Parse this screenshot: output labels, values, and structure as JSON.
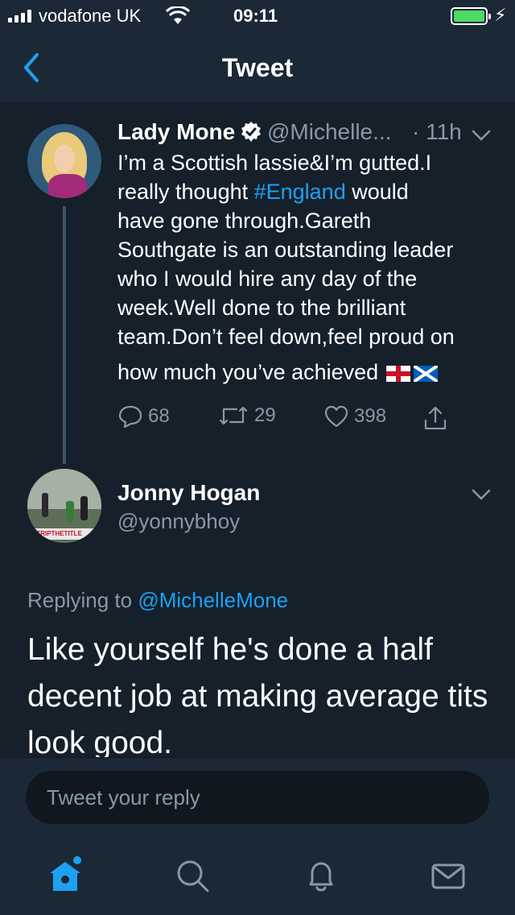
{
  "status_bar": {
    "carrier": "vodafone UK",
    "time": "09:11",
    "colors": {
      "battery": "#4cd964"
    }
  },
  "header": {
    "title": "Tweet",
    "back_icon": "chevron-left-icon"
  },
  "tweet": {
    "author_name": "Lady Mone",
    "verified": true,
    "handle": "@Michelle...",
    "time": "· 11h",
    "body_lines": [
      [
        "I’m a Scottish lassie&I’m gutted.I",
        ""
      ],
      [
        "really thought ",
        "#England",
        " would"
      ],
      [
        "have gone through.Gareth",
        ""
      ],
      [
        "Southgate is an outstanding leader",
        ""
      ],
      [
        "who I would hire any day of the",
        ""
      ],
      [
        "week.Well done to the brilliant",
        ""
      ],
      [
        "team.Don’t feel down,feel proud on",
        ""
      ],
      [
        "how much you’ve achieved",
        ""
      ]
    ],
    "body": {
      "l1": "I’m a Scottish lassie&I’m gutted.I",
      "l2a": "really thought ",
      "l2_hashtag": "#England",
      "l2b": " would",
      "l3": "have gone through.Gareth",
      "l4": "Southgate is an outstanding leader",
      "l5": "who I would hire any day of the",
      "l6": "week.Well done to the brilliant",
      "l7": "team.Don’t feel down,feel proud on",
      "l8": "how much you’ve achieved"
    },
    "emoji": [
      "england-flag-icon",
      "scotland-flag-icon"
    ],
    "actions": {
      "replies": "68",
      "retweets": "29",
      "likes": "398"
    }
  },
  "reply": {
    "author_name": "Jonny Hogan",
    "handle": "@yonnybhoy",
    "avatar_text": "STRIPTHETITLE",
    "replying_prefix": "Replying to ",
    "replying_to": "@MichelleMone",
    "text_lines": {
      "l1": "Like yourself he's done a half",
      "l2": "decent job at making average tits",
      "l3": "look good."
    }
  },
  "composer": {
    "placeholder": "Tweet your reply"
  },
  "tab_bar": {
    "items": [
      "home-icon",
      "search-icon",
      "bell-icon",
      "mail-icon"
    ],
    "active": "home-icon"
  },
  "colors": {
    "background": "#15202b",
    "bar": "#1b2836",
    "accent": "#1da1f2",
    "secondary_text": "#8899a6"
  }
}
